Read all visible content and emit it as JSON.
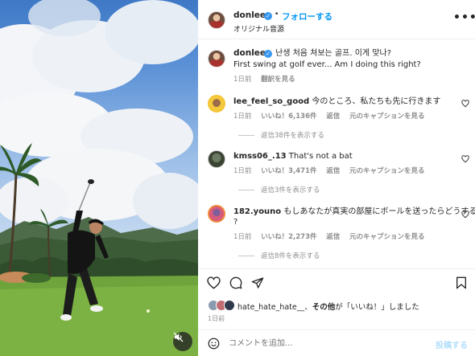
{
  "header": {
    "username": "donlee",
    "follow_label": "フォローする",
    "subtitle": "オリジナル音源",
    "more_icon": "more-horizontal-icon"
  },
  "caption": {
    "username": "donlee",
    "line1": "난생 처음 쳐보는 골프. 이게 맞나?",
    "line2": "First swing at golf ever... Am I doing this right?",
    "time": "1日前",
    "see_translation": "翻訳を見る"
  },
  "comments": [
    {
      "username": "lee_feel_so_good",
      "text": "今のところ、私たちも先に行きます",
      "time": "1日前",
      "likes": "いいね！6,136件",
      "reply": "返信",
      "see_caption": "元のキャプションを見る",
      "view_replies": "返信38件を表示する"
    },
    {
      "username": "kmss06_.13",
      "text": "That's not a bat",
      "time": "1日前",
      "likes": "いいね！3,471件",
      "reply": "返信",
      "see_caption": "元のキャプションを見る",
      "view_replies": "返信3件を表示する"
    },
    {
      "username": "182.youno",
      "text_line1": "もしあなたが真実の部屋にボールを送ったらどうする",
      "text_line2": "?",
      "time": "1日前",
      "likes": "いいね！2,273件",
      "reply": "返信",
      "see_caption": "元のキャプションを見る",
      "view_replies": "返信8件を表示する"
    }
  ],
  "likes_summary": {
    "liker": "hate_hate_hate__",
    "separator": "、",
    "others": "その他",
    "suffix": "が「いいね！」しました"
  },
  "date": "1日前",
  "comment_bar": {
    "placeholder": "コメントを追加...",
    "post_label": "投稿する"
  },
  "colors": {
    "link_blue": "#0095f6",
    "verified_blue": "#3897f0",
    "muted_gray": "#8e8e8e",
    "text": "#262626"
  }
}
